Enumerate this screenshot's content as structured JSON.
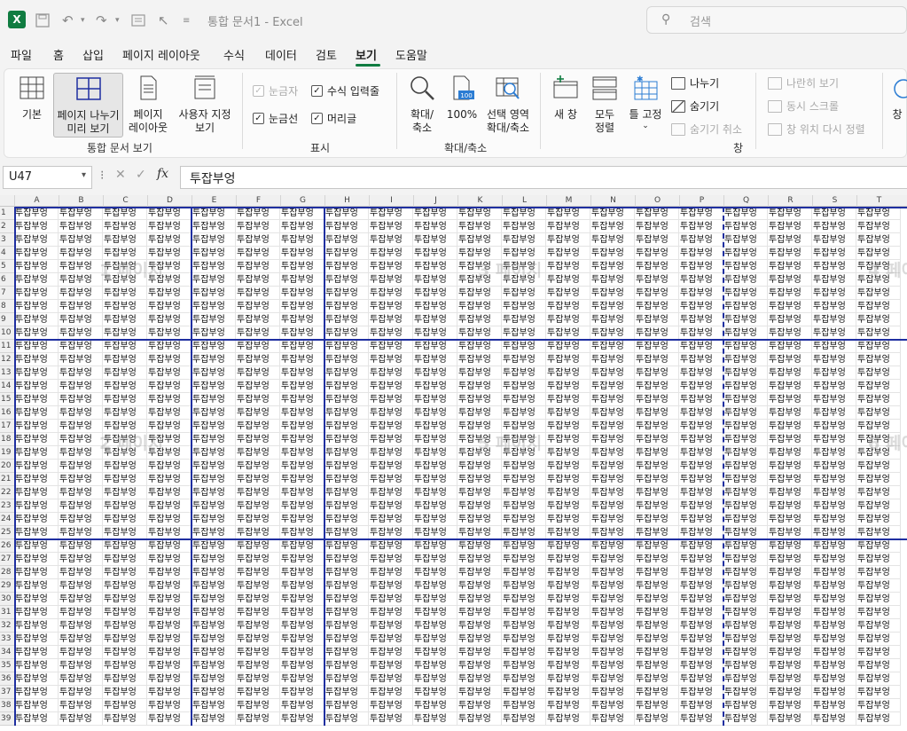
{
  "titlebar": {
    "doc_title": "통합 문서1 - Excel",
    "search_placeholder": "검색",
    "app_icon": "excel-icon"
  },
  "menu": {
    "tabs": [
      "파일",
      "홈",
      "삽입",
      "페이지 레이아웃",
      "수식",
      "데이터",
      "검토",
      "보기",
      "도움말"
    ],
    "active": "보기"
  },
  "ribbon": {
    "workbook_views": {
      "label": "통합 문서 보기",
      "normal": "기본",
      "page_break_1": "페이지 나누기",
      "page_break_2": "미리 보기",
      "page_layout_1": "페이지",
      "page_layout_2": "레이아웃",
      "custom_1": "사용자 지정",
      "custom_2": "보기"
    },
    "show": {
      "label": "표시",
      "ruler": "눈금자",
      "formula_bar": "수식 입력줄",
      "gridlines": "눈금선",
      "headings": "머리글"
    },
    "zoom": {
      "label": "확대/축소",
      "zoom_1": "확대/",
      "zoom_2": "축소",
      "hundred": "100%",
      "selection_1": "선택 영역",
      "selection_2": "확대/축소"
    },
    "window": {
      "label": "창",
      "new_window": "새 창",
      "arrange_1": "모두",
      "arrange_2": "정렬",
      "freeze": "틀 고정",
      "split": "나누기",
      "hide": "숨기기",
      "unhide": "숨기기 취소",
      "side_by_side": "나란히 보기",
      "sync_scroll": "동시 스크롤",
      "reset_position": "창 위치 다시 정렬",
      "switch": "창"
    }
  },
  "formula_bar": {
    "name_box": "U47",
    "formula": "투잡부엉"
  },
  "sheet": {
    "columns": [
      "A",
      "B",
      "C",
      "D",
      "E",
      "F",
      "G",
      "H",
      "I",
      "J",
      "K",
      "L",
      "M",
      "N",
      "O",
      "P",
      "Q",
      "R",
      "S",
      "T"
    ],
    "rows": [
      "1",
      "2",
      "3",
      "4",
      "5",
      "6",
      "7",
      "8",
      "9",
      "10",
      "11",
      "12",
      "13",
      "14",
      "15",
      "16",
      "17",
      "18",
      "19",
      "20",
      "21",
      "22",
      "23",
      "24",
      "25",
      "26",
      "27",
      "28",
      "29",
      "30",
      "31",
      "32",
      "33",
      "34",
      "35",
      "36",
      "37",
      "38",
      "39"
    ],
    "cell_value": "투잡부엉",
    "watermarks": [
      {
        "text": "1 페이지"
      },
      {
        "text": "3 페이지"
      },
      {
        "text": "4 페이지"
      },
      {
        "text": "2 페이지"
      },
      {
        "text": "5 페이지"
      },
      {
        "text": "6 페이지"
      }
    ]
  }
}
